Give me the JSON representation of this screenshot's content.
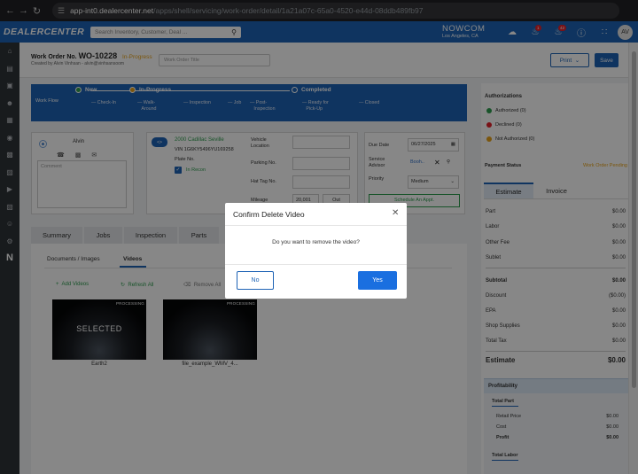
{
  "browser": {
    "url_host": "app-int0.dealercenter.net",
    "url_path": "/apps/shell/servicing/work-order/detail/1a21a07c-65a0-4520-e44d-08ddb489fb97"
  },
  "header": {
    "logo": "DEALERCENTER",
    "search_placeholder": "Search Inventory, Customer, Deal ...",
    "dealer_name": "NOWCOM",
    "dealer_location": "Los Angeles, CA",
    "notif_badge_1": "1",
    "notif_badge_2": "42",
    "avatar_initials": "AV"
  },
  "work_order": {
    "label": "Work Order No.",
    "number": "WO-10228",
    "status": "In-Progress",
    "created_by": "Created by Alvin Vinhsan - alvin@vinhsansoom",
    "title_placeholder": "Work Order Title",
    "print_label": "Print",
    "save_label": "Save"
  },
  "workflow": {
    "label": "Work Flow",
    "stages": {
      "new": "New",
      "in_progress": "In-Progress",
      "completed": "Completed"
    },
    "steps": {
      "check_in": "Check-In",
      "walk_around_1": "Walk-",
      "walk_around_2": "Around",
      "inspection": "Inspection",
      "job": "Job",
      "post_inspection_1": "Post-",
      "post_inspection_2": "Inspection",
      "ready_pickup_1": "Ready for",
      "ready_pickup_2": "Pick-Up",
      "closed": "Closed"
    }
  },
  "customer": {
    "name": "Alvin",
    "comment_placeholder": "Comment"
  },
  "vehicle": {
    "tag": "<>",
    "name": "2000 Cadillac Seville",
    "vin": "VIN 1G6KY5496YU169258",
    "plate_label": "Plate No.",
    "recon_label": "In Recon",
    "location_label_1": "Vehicle",
    "location_label_2": "Location",
    "parking_label": "Parking No.",
    "hat_tag_label": "Hat Tag No.",
    "mileage_label": "Mileage",
    "mileage_value": "20,001",
    "out_label": "Out"
  },
  "dates": {
    "due_label": "Due Date",
    "due_value": "06/27/2025",
    "advisor_label_1": "Service",
    "advisor_label_2": "Advisor",
    "advisor_value": "Booh..",
    "priority_label": "Priority",
    "priority_value": "Medium",
    "schedule_label": "Schedule An Appt."
  },
  "tabs": {
    "summary": "Summary",
    "jobs": "Jobs",
    "inspection": "Inspection",
    "parts": "Parts"
  },
  "subtabs": {
    "documents": "Documents / Images",
    "videos": "Videos"
  },
  "actions": {
    "add_videos": "Add Videos",
    "refresh_all": "Refresh All",
    "remove_all": "Remove All"
  },
  "videos": [
    {
      "status": "PROCESSING",
      "overlay": "SELECTED",
      "name": "Earth2"
    },
    {
      "status": "PROCESSING",
      "overlay": "",
      "name": "file_example_WMV_4..."
    }
  ],
  "authorizations": {
    "title": "Authorizations",
    "authorized": "Authorized (0)",
    "declined": "Declined (0)",
    "not_authorized": "Not Authorized (0)",
    "colors": {
      "authorized": "#2e9d4f",
      "declined": "#e5212a",
      "not_authorized": "#e8a31a"
    }
  },
  "payment": {
    "label": "Payment Status",
    "value": "Work Order Pending"
  },
  "estimate": {
    "tab_estimate": "Estimate",
    "tab_invoice": "Invoice",
    "rows": [
      {
        "label": "Part",
        "value": "$0.00"
      },
      {
        "label": "Labor",
        "value": "$0.00"
      },
      {
        "label": "Other Fee",
        "value": "$0.00"
      },
      {
        "label": "Sublet",
        "value": "$0.00"
      }
    ],
    "subtotal": {
      "label": "Subtotal",
      "value": "$0.00"
    },
    "rows2": [
      {
        "label": "Discount",
        "value": "($0.00)"
      },
      {
        "label": "EPA",
        "value": "$0.00"
      },
      {
        "label": "Shop Supplies",
        "value": "$0.00"
      },
      {
        "label": "Total Tax",
        "value": "$0.00"
      }
    ],
    "total": {
      "label": "Estimate",
      "value": "$0.00"
    }
  },
  "profitability": {
    "title": "Profitability",
    "total_part": "Total Part",
    "retail_price": {
      "label": "Retail Price",
      "value": "$0.00"
    },
    "cost": {
      "label": "Cost",
      "value": "$0.00"
    },
    "profit": {
      "label": "Profit",
      "value": "$0.00"
    },
    "total_labor": "Total Labor"
  },
  "modal": {
    "title": "Confirm Delete Video",
    "message": "Do you want to remove the video?",
    "no_label": "No",
    "yes_label": "Yes"
  }
}
